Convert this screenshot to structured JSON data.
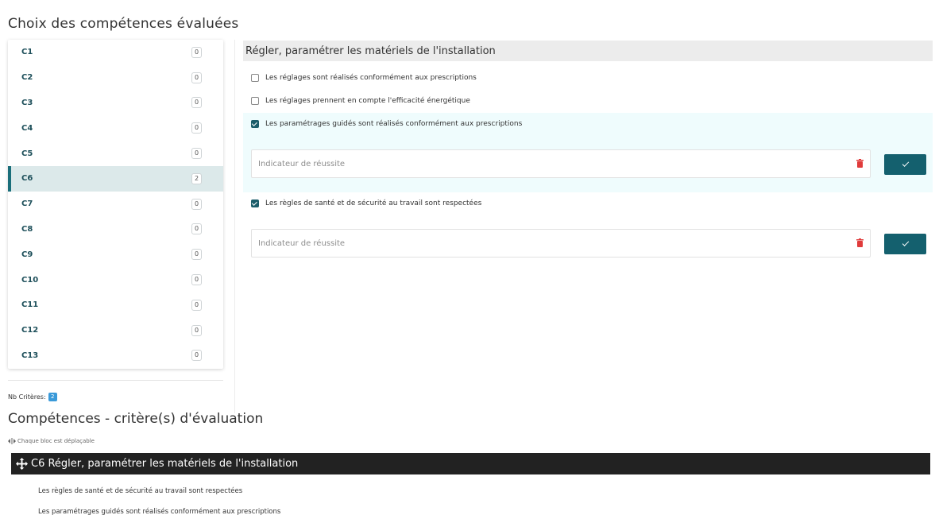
{
  "page_title": "Choix des compétences évaluées",
  "competences": [
    {
      "label": "C1",
      "count": "0"
    },
    {
      "label": "C2",
      "count": "0"
    },
    {
      "label": "C3",
      "count": "0"
    },
    {
      "label": "C4",
      "count": "0"
    },
    {
      "label": "C5",
      "count": "0"
    },
    {
      "label": "C6",
      "count": "2",
      "active": true
    },
    {
      "label": "C7",
      "count": "0"
    },
    {
      "label": "C8",
      "count": "0"
    },
    {
      "label": "C9",
      "count": "0"
    },
    {
      "label": "C10",
      "count": "0"
    },
    {
      "label": "C11",
      "count": "0"
    },
    {
      "label": "C12",
      "count": "0"
    },
    {
      "label": "C13",
      "count": "0"
    }
  ],
  "nb_criteres": {
    "label": "Nb Critères:",
    "value": "2"
  },
  "panel": {
    "title": "Régler, paramétrer les matériels de l'installation",
    "criteria": [
      {
        "label": "Les réglages sont réalisés conformément aux prescriptions",
        "checked": false
      },
      {
        "label": "Les réglages prennent en compte l'efficacité énergétique",
        "checked": false
      },
      {
        "label": "Les paramétrages guidés sont réalisés conformément aux prescriptions",
        "checked": true
      },
      {
        "label": "Les règles de santé et de sécurité au travail sont respectées",
        "checked": true
      }
    ],
    "indicator_placeholder_1": "Indicateur de réussite",
    "indicator_placeholder_2": "Indicateur de réussite"
  },
  "section": {
    "title": "Compétences - critère(s) d'évaluation",
    "hint": "Chaque bloc est déplaçable",
    "bloc_title": "C6 Régler, paramétrer les matériels de l'installation",
    "bloc_items": [
      "Les règles de santé et de sécurité au travail sont respectées",
      "Les paramétrages guidés sont réalisés conformément aux prescriptions"
    ]
  },
  "colors": {
    "accent": "#14606e",
    "active_bg": "#dce9ea",
    "danger": "#e03b3b",
    "info": "#3a9ad9"
  },
  "icons": [
    "check-icon",
    "trash-icon",
    "move-icon",
    "drag-hint-icon"
  ]
}
